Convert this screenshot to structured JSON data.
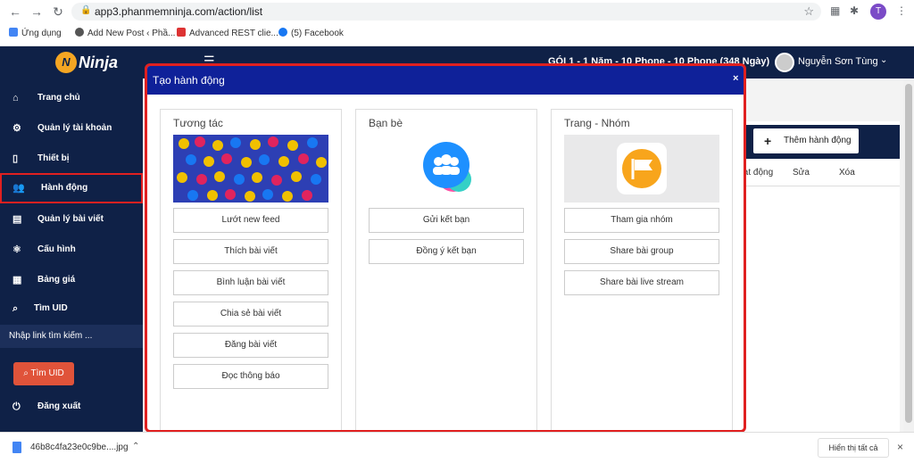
{
  "browser": {
    "url": "app3.phanmemninja.com/action/list",
    "bookmarks": [
      {
        "label": "Ứng dụng"
      },
      {
        "label": "Add New Post ‹ Phầ..."
      },
      {
        "label": "Advanced REST clie..."
      },
      {
        "label": "(5) Facebook"
      }
    ],
    "profile_initial": "T"
  },
  "app": {
    "logo_text": "Ninja",
    "logo_mark": "N",
    "package": "GÓI 1 - 1 Năm - 10 Phone - 10 Phone (348 Ngày)",
    "user_name": "Nguyễn Sơn Tùng",
    "sidebar": {
      "items": [
        {
          "label": "Trang chủ",
          "icon": "home-icon"
        },
        {
          "label": "Quản lý tài khoản",
          "icon": "gear-icon"
        },
        {
          "label": "Thiết bị",
          "icon": "phone-icon"
        },
        {
          "label": "Hành động",
          "icon": "users-icon"
        },
        {
          "label": "Quản lý bài viết",
          "icon": "book-icon"
        },
        {
          "label": "Cấu hình",
          "icon": "atom-icon"
        },
        {
          "label": "Bảng giá",
          "icon": "calendar-icon"
        },
        {
          "label": "Tìm UID",
          "icon": "search-icon"
        }
      ],
      "search_link_text": "Nhập link tìm kiếm ...",
      "search_button": "Tìm UID",
      "logout": "Đăng xuất"
    },
    "card": {
      "add_button": "Thêm hành động",
      "columns": [
        "Hoạt động",
        "Sửa",
        "Xóa"
      ]
    }
  },
  "modal": {
    "title": "Tạo hành động",
    "close": "×",
    "panels": [
      {
        "title": "Tương tác",
        "actions": [
          "Lướt new feed",
          "Thích bài viết",
          "Bình luận bài viết",
          "Chia sẻ bài viết",
          "Đăng bài viết",
          "Đọc thông báo"
        ]
      },
      {
        "title": "Bạn bè",
        "actions": [
          "Gửi kết bạn",
          "Đồng ý kết bạn"
        ]
      },
      {
        "title": "Trang - Nhóm",
        "actions": [
          "Tham gia nhóm",
          "Share bài group",
          "Share bài live stream"
        ]
      }
    ]
  },
  "downloads": {
    "file_name": "46b8c4fa23e0c9be....jpg",
    "show_all": "Hiển thị tất cả"
  },
  "colors": {
    "navy": "#0f2147",
    "modal_header": "#0f2199",
    "highlight": "#e02020",
    "uid_button": "#e0533a"
  }
}
